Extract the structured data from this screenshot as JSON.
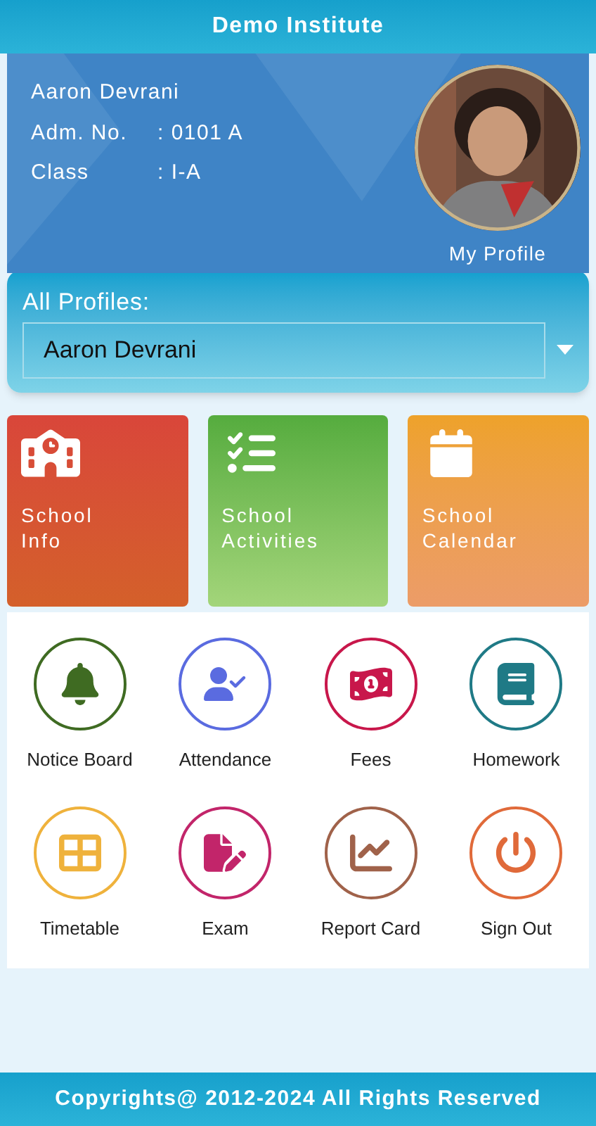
{
  "header": {
    "title": "Demo Institute"
  },
  "student": {
    "name": "Aaron Devrani",
    "adm_label": "Adm. No.",
    "adm_value": ": 0101 A",
    "class_label": "Class",
    "class_value": ": I-A",
    "profile_link": "My Profile"
  },
  "profiles": {
    "label": "All Profiles:",
    "value": "Aaron Devrani"
  },
  "tiles": [
    {
      "title": "School Info"
    },
    {
      "title": "School Activities"
    },
    {
      "title": "School Calendar"
    }
  ],
  "menu": [
    {
      "label": "Notice Board",
      "color": "#3f6b22"
    },
    {
      "label": "Attendance",
      "color": "#5a6be0"
    },
    {
      "label": "Fees",
      "color": "#c8174b"
    },
    {
      "label": "Homework",
      "color": "#1f7a86"
    },
    {
      "label": "Timetable",
      "color": "#efb23c"
    },
    {
      "label": "Exam",
      "color": "#c2256a"
    },
    {
      "label": "Report Card",
      "color": "#a0624a"
    },
    {
      "label": "Sign Out",
      "color": "#e06a3a"
    }
  ],
  "footer": {
    "text": "Copyrights@ 2012-2024 All Rights Reserved"
  }
}
